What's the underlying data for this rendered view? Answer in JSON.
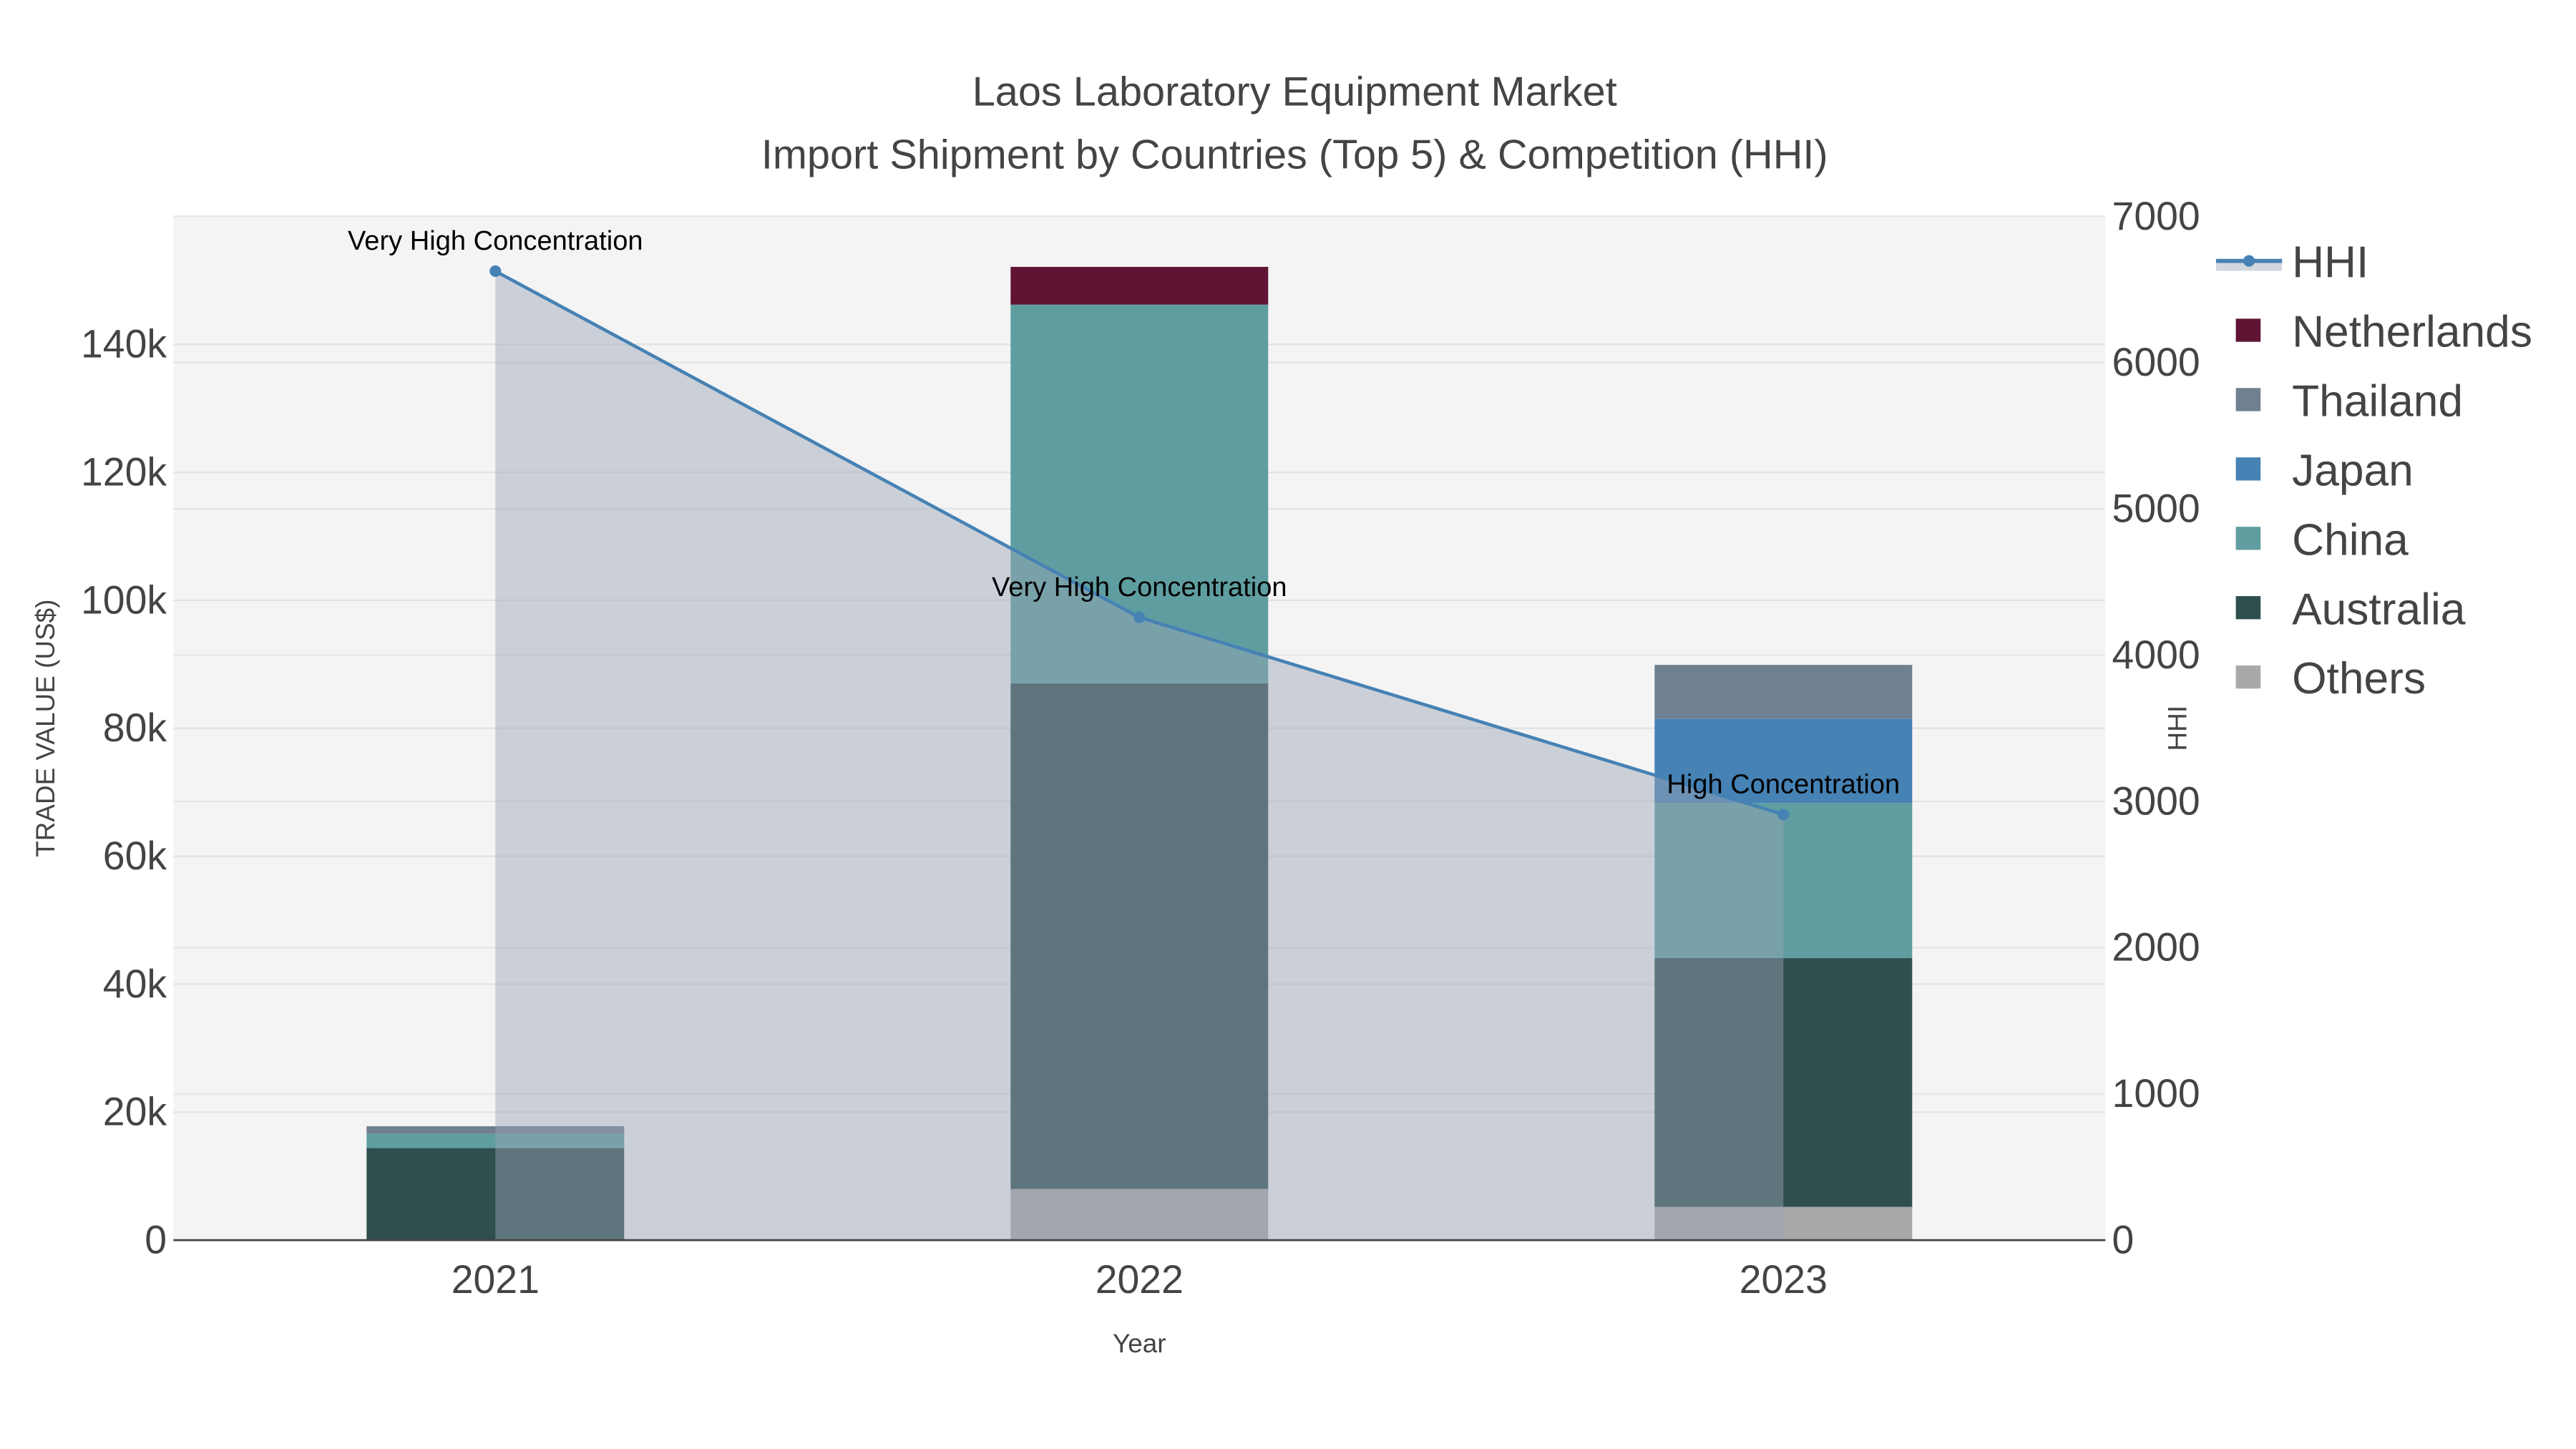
{
  "chart_data": {
    "type": "bar",
    "title_line1": "Laos Laboratory Equipment Market",
    "title_line2": "Import Shipment by Countries (Top 5) & Competition (HHI)",
    "xlabel": "Year",
    "ylabel": "TRADE VALUE (US$)",
    "y2label": "HHI",
    "categories": [
      "2021",
      "2022",
      "2023"
    ],
    "ylim": [
      0,
      160000
    ],
    "y_ticks": [
      0,
      20000,
      40000,
      60000,
      80000,
      100000,
      120000,
      140000
    ],
    "y_tick_labels": [
      "0",
      "20k",
      "40k",
      "60k",
      "80k",
      "100k",
      "120k",
      "140k"
    ],
    "y2lim": [
      0,
      7000
    ],
    "y2_ticks": [
      0,
      1000,
      2000,
      3000,
      4000,
      5000,
      6000,
      7000
    ],
    "y2_tick_labels": [
      "0",
      "1000",
      "2000",
      "3000",
      "4000",
      "5000",
      "6000",
      "7000"
    ],
    "grid": true,
    "legend_position": "right",
    "series": [
      {
        "name": "Others",
        "color": "#A9A9A9",
        "values": [
          0,
          8000,
          5200
        ]
      },
      {
        "name": "Australia",
        "color": "#2F4F4F",
        "values": [
          14400,
          79000,
          38900
        ]
      },
      {
        "name": "China",
        "color": "#5F9EA0",
        "values": [
          2200,
          59200,
          24200
        ]
      },
      {
        "name": "Japan",
        "color": "#4682B4",
        "values": [
          0,
          0,
          13200
        ]
      },
      {
        "name": "Thailand",
        "color": "#708090",
        "values": [
          1200,
          0,
          8400
        ]
      },
      {
        "name": "Netherlands",
        "color": "#601434",
        "values": [
          0,
          5900,
          0
        ]
      }
    ],
    "hhi": {
      "name": "HHI",
      "color": "#4682B4",
      "fill": "#9AA3B5",
      "values": [
        6625,
        4258,
        2910
      ],
      "annotations": [
        "Very High Concentration",
        "Very High Concentration",
        "High Concentration"
      ]
    },
    "legend_order": [
      "HHI",
      "Netherlands",
      "Thailand",
      "Japan",
      "China",
      "Australia",
      "Others"
    ]
  }
}
